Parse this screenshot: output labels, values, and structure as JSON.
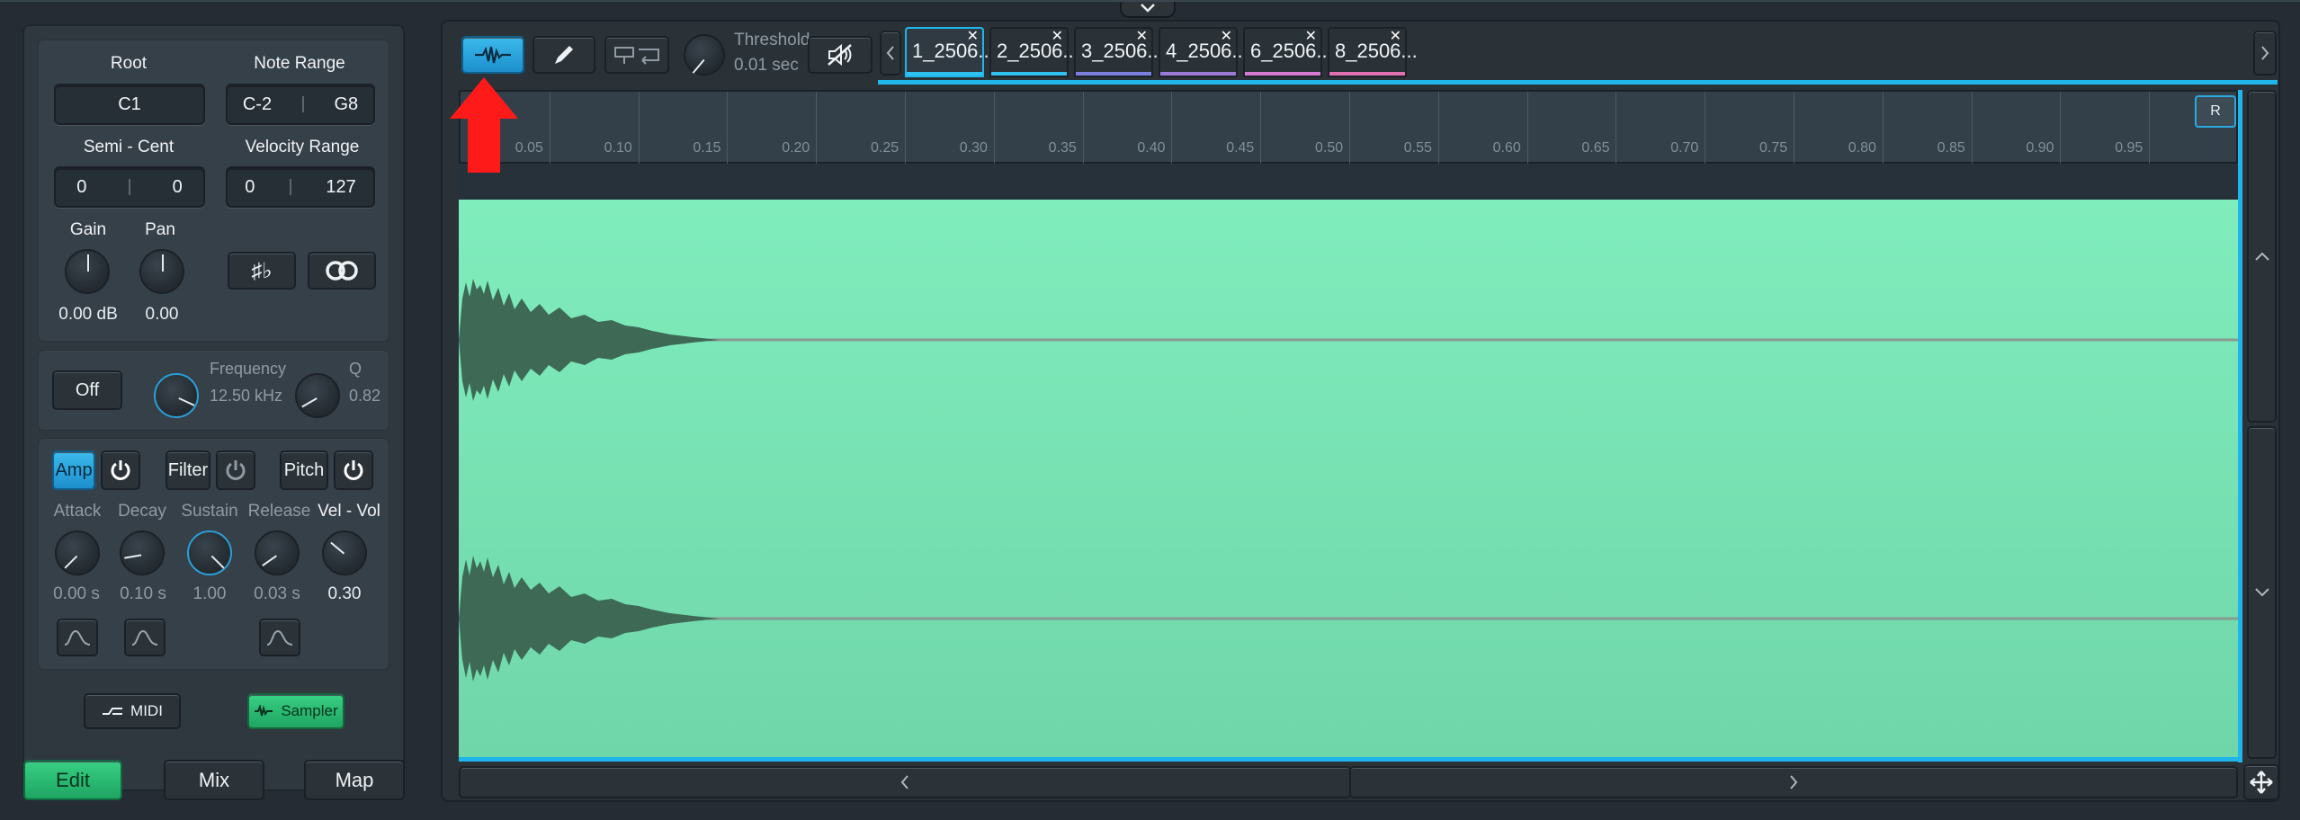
{
  "top_toggle_icon": "chevron-down-icon",
  "left": {
    "root_label": "Root",
    "root_value": "C1",
    "note_range_label": "Note Range",
    "note_range_low": "C-2",
    "note_range_high": "G8",
    "semi_cent_label": "Semi - Cent",
    "semi_value": "0",
    "cent_value": "0",
    "velocity_range_label": "Velocity Range",
    "velocity_low": "0",
    "velocity_high": "127",
    "gain_label": "Gain",
    "gain_value": "0.00 dB",
    "pan_label": "Pan",
    "pan_value": "0.00",
    "sharp_flat_icon": "sharp-flat-icon",
    "loop_icon": "loop-icon",
    "filter_off_label": "Off",
    "frequency_label": "Frequency",
    "frequency_value": "12.50 kHz",
    "q_label": "Q",
    "q_value": "0.82",
    "amp_label": "Amp",
    "filter_label": "Filter",
    "pitch_label": "Pitch",
    "attack_label": "Attack",
    "decay_label": "Decay",
    "sustain_label": "Sustain",
    "release_label": "Release",
    "velvol_label": "Vel - Vol",
    "attack_value": "0.00 s",
    "decay_value": "0.10 s",
    "sustain_value": "1.00",
    "release_value": "0.03 s",
    "velvol_value": "0.30",
    "midi_label": "MIDI",
    "sampler_label": "Sampler"
  },
  "bottom_tabs": {
    "edit": "Edit",
    "mix": "Mix",
    "map": "Map"
  },
  "toolbar": {
    "threshold_label": "Threshold",
    "threshold_value": "0.01 sec"
  },
  "sample_tabs": [
    {
      "label": "1_2506...",
      "color": "#2fc1f0"
    },
    {
      "label": "2_2506...",
      "color": "#2fc1f0"
    },
    {
      "label": "3_2506...",
      "color": "#7b7fe0"
    },
    {
      "label": "4_2506...",
      "color": "#9b7ad8"
    },
    {
      "label": "6_2506...",
      "color": "#d57ad0"
    },
    {
      "label": "8_2506...",
      "color": "#e070b0"
    }
  ],
  "ruler": {
    "labels": [
      "0.05",
      "0.10",
      "0.15",
      "0.20",
      "0.25",
      "0.30",
      "0.35",
      "0.40",
      "0.45",
      "0.50",
      "0.55",
      "0.60",
      "0.65",
      "0.70",
      "0.75",
      "0.80",
      "0.85",
      "0.90",
      "0.95"
    ],
    "r_marker": "R"
  },
  "colors": {
    "accent_blue": "#1fb6ec",
    "waveform_bg": "#7de9b9",
    "waveform": "#3e6a55",
    "annotation_arrow": "#ff1a1a"
  }
}
